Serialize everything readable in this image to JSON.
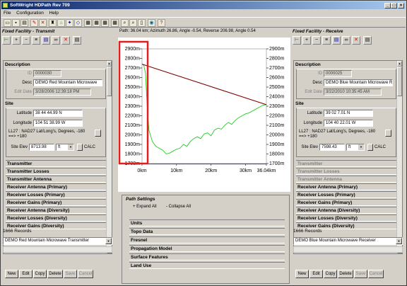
{
  "window": {
    "title": "SoftWright HDPath Rev 709"
  },
  "menu": [
    "File",
    "Configuration",
    "Help"
  ],
  "toolbar_icons": [
    "open-folder-icon",
    "save-icon",
    "print-icon",
    "edit-icon",
    "delete-icon",
    "tower-icon",
    "profile-icon",
    "map-icon",
    "map-icon",
    "image-icon",
    "image-icon",
    "image-icon",
    "zoom-icon",
    "find-icon",
    "page-icon",
    "globe-icon",
    "help-icon"
  ],
  "path_info": "Path: 36.04 km; Azimuth 26.86, Angle -0.54, Reverse 206.98, Angle 0.54",
  "left": {
    "title": "Fixed Facility - Transmit",
    "description_title": "Description",
    "id_label": "ID",
    "id_value": "0000030",
    "desc_label": "Desc",
    "desc_value": "DEMO Red Mountain Microwave",
    "edit_label": "Edit Date",
    "edit_value": "3/28/2006 12:39:18 PM",
    "site_title": "Site",
    "lat_label": "Latitude",
    "lat_value": "38 44 44.99 N",
    "lon_label": "Longitude",
    "lon_value": "104 51 38.99 W",
    "datum": "LL27 : NAD27 Lat/Long's, Degrees, -180 ==> +180",
    "elev_label": "Site Elev",
    "elev_value": "8713.98",
    "elev_unit": "ft",
    "calc": "CALC",
    "sections": [
      {
        "label": "Transmitter",
        "disabled": false
      },
      {
        "label": "Transmitter Losses",
        "disabled": false
      },
      {
        "label": "Transmitter Antenna",
        "disabled": false
      },
      {
        "label": "Receiver Antenna (Primary)",
        "disabled": false
      },
      {
        "label": "Receiver Losses (Primary)",
        "disabled": false
      },
      {
        "label": "Receiver Gains (Primary)",
        "disabled": false
      },
      {
        "label": "Receiver Antenna (Diversity)",
        "disabled": false
      },
      {
        "label": "Receiver Losses (Diversity)",
        "disabled": false
      },
      {
        "label": "Receiver Gains (Diversity)",
        "disabled": false
      }
    ],
    "records": "1666 Records",
    "combo": "DEMO Red Mountain Microwave Transmitter",
    "buttons": [
      {
        "label": "New",
        "disabled": false
      },
      {
        "label": "Edit",
        "disabled": false
      },
      {
        "label": "Copy",
        "disabled": false
      },
      {
        "label": "Delete",
        "disabled": false
      },
      {
        "label": "Save",
        "disabled": true
      },
      {
        "label": "Cancel",
        "disabled": true
      }
    ]
  },
  "right": {
    "title": "Fixed Facility - Receive",
    "description_title": "Description",
    "id_label": "ID",
    "id_value": "0000025",
    "desc_label": "Desc",
    "desc_value": "DEMO Blue Mountain Microwave R",
    "edit_label": "Edit Date",
    "edit_value": "3/22/2010 10:35:45 AM",
    "site_title": "Site",
    "lat_label": "Latitude",
    "lat_value": "39 02 7.01 N",
    "lon_label": "Longitude",
    "lon_value": "104 40 22.01 W",
    "datum": "LL27 : NAD27 Lat/Long's, Degrees, -180 ==> +180",
    "elev_label": "Site Elev",
    "elev_value": "7598.43",
    "elev_unit": "ft",
    "calc": "CALC",
    "sections": [
      {
        "label": "Transmitter",
        "disabled": true
      },
      {
        "label": "Transmitter Losses",
        "disabled": true
      },
      {
        "label": "Transmitter Antenna",
        "disabled": true
      },
      {
        "label": "Receiver Antenna (Primary)",
        "disabled": false
      },
      {
        "label": "Receiver Losses (Primary)",
        "disabled": false
      },
      {
        "label": "Receiver Gains (Primary)",
        "disabled": false
      },
      {
        "label": "Receiver Antenna (Diversity)",
        "disabled": false
      },
      {
        "label": "Receiver Losses (Diversity)",
        "disabled": false
      },
      {
        "label": "Receiver Gains (Diversity)",
        "disabled": false
      }
    ],
    "records": "1666 Records",
    "combo": "DEMO Blue Mountain Microwave Receiver",
    "buttons": [
      {
        "label": "New",
        "disabled": false
      },
      {
        "label": "Edit",
        "disabled": false
      },
      {
        "label": "Copy",
        "disabled": false
      },
      {
        "label": "Delete",
        "disabled": false
      },
      {
        "label": "Save",
        "disabled": true
      },
      {
        "label": "Cancel",
        "disabled": true
      }
    ]
  },
  "path_settings": {
    "title": "Path Settings",
    "expand": "+ Expand All",
    "collapse": "- Collapse All",
    "rows": [
      "Units",
      "Topo Data",
      "Fresnel",
      "Propagation Model",
      "Surface Features",
      "Land Use"
    ]
  },
  "colors": {
    "terrain": "#22cc22",
    "path_line": "#800000",
    "baseline": "#3333cc",
    "highlight": "#e02020"
  },
  "chart_data": {
    "type": "line",
    "y_ticks": [
      "2900m",
      "2800m",
      "2700m",
      "2600m",
      "2500m",
      "2400m",
      "2300m",
      "2200m",
      "2100m",
      "2000m",
      "1900m",
      "1800m",
      "1700m"
    ],
    "x_ticks": [
      "0km",
      "10km",
      "20km",
      "30km",
      "36.04km"
    ],
    "xlim": [
      0,
      36.04
    ],
    "ylim": [
      1700,
      2900
    ],
    "series": [
      {
        "x": [
          0,
          0.5,
          1,
          1.5,
          2,
          3,
          4,
          5,
          6,
          7,
          8,
          9,
          10,
          11,
          12,
          13,
          14,
          15,
          16,
          17,
          18,
          19,
          20,
          21,
          22,
          23,
          24,
          25,
          26,
          27,
          28,
          29,
          30,
          31,
          32,
          33,
          34,
          35,
          36.04
        ],
        "y": [
          2740,
          2730,
          2650,
          2300,
          2050,
          1930,
          1880,
          1860,
          1840,
          1800,
          1810,
          1830,
          1850,
          1860,
          1900,
          1880,
          1930,
          1960,
          1980,
          1960,
          2010,
          2020,
          1990,
          2050,
          2070,
          2060,
          2100,
          2130,
          2110,
          2150,
          2180,
          2200,
          2220,
          2230,
          2250,
          2270,
          2290,
          2310,
          2316
        ]
      },
      {
        "x": [
          0,
          36.04
        ],
        "y": [
          2740,
          2316
        ]
      },
      {
        "x": [
          0,
          36.04
        ],
        "y": [
          1695,
          1695
        ]
      }
    ]
  }
}
